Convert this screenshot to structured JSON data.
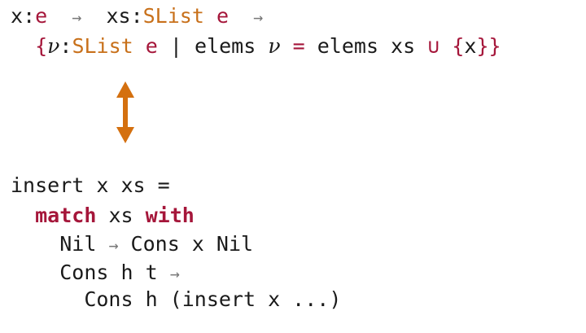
{
  "spec": {
    "line1": {
      "x": "x",
      "colon1": ":",
      "e1": "e",
      "arrow1": "→",
      "xs": "xs",
      "colon2": ":",
      "slist1": "SList",
      "e2": "e",
      "arrow2": "→"
    },
    "line2": {
      "open_brace": "{",
      "nu1": "ν",
      "colon": ":",
      "slist2": "SList",
      "e3": "e",
      "bar": "|",
      "elems1": "elems",
      "nu2": "ν",
      "eq": "=",
      "elems2": "elems xs",
      "union": "∪",
      "set_open": "{",
      "set_x": "x",
      "set_close": "}",
      "close_brace": "}"
    }
  },
  "connector": {
    "icon": "double-headed-vertical-arrow",
    "color": "#d4700f"
  },
  "program": {
    "header": "insert x xs =",
    "match_kw": "match",
    "match_scrutinee": "xs",
    "with_kw": "with",
    "case1_pattern": "Nil",
    "case1_arrow": "→",
    "case1_body": "Cons x Nil",
    "case2_pattern": "Cons h t",
    "case2_arrow": "→",
    "case2_body": "Cons h (insert x ...)"
  },
  "colors": {
    "type_name": "#c8701a",
    "keyword": "#a5163a",
    "text": "#1a1a1a"
  }
}
